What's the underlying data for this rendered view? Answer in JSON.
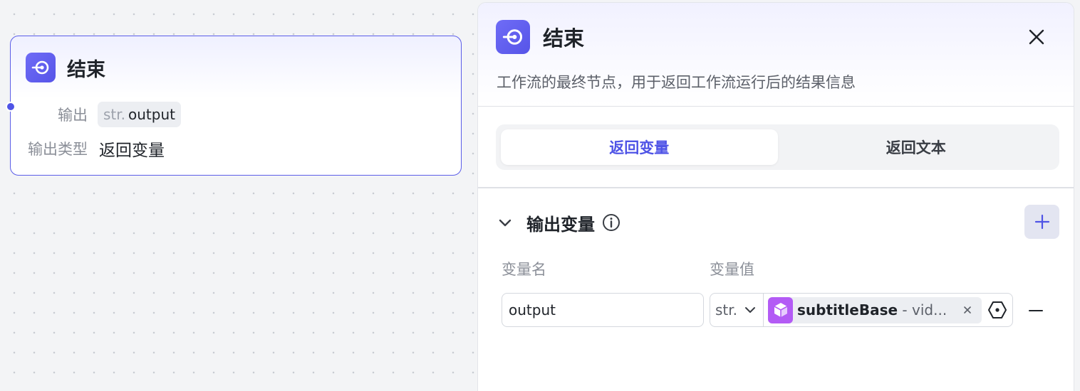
{
  "node": {
    "title": "结束",
    "icon": "end-node-icon",
    "output_label": "输出",
    "output_chip_type": "str.",
    "output_chip_name": "output",
    "output_type_label": "输出类型",
    "output_type_value": "返回变量"
  },
  "panel": {
    "title": "结束",
    "icon": "end-node-icon",
    "description": "工作流的最终节点，用于返回工作流运行后的结果信息",
    "close_icon": "close-icon",
    "tabs": [
      {
        "label": "返回变量",
        "active": true
      },
      {
        "label": "返回文本",
        "active": false
      }
    ],
    "section": {
      "title": "输出变量",
      "collapse_icon": "chevron-down-icon",
      "info_icon": "info-icon",
      "add_icon": "plus-icon",
      "col_name": "变量名",
      "col_value": "变量值"
    },
    "row": {
      "name": "output",
      "type": "str.",
      "ref_icon": "cube-icon",
      "ref_node": "subtitleBase",
      "ref_rest": " - vid...",
      "clear_icon": "close-small-icon",
      "variable_icon": "variable-hex-icon",
      "remove_icon": "minus-icon"
    }
  },
  "colors": {
    "accent": "#4f54e6",
    "node_icon_bg": "#5f5cf0",
    "ref_icon_bg": "#b35bf5",
    "canvas_bg": "#f3f4f6"
  }
}
